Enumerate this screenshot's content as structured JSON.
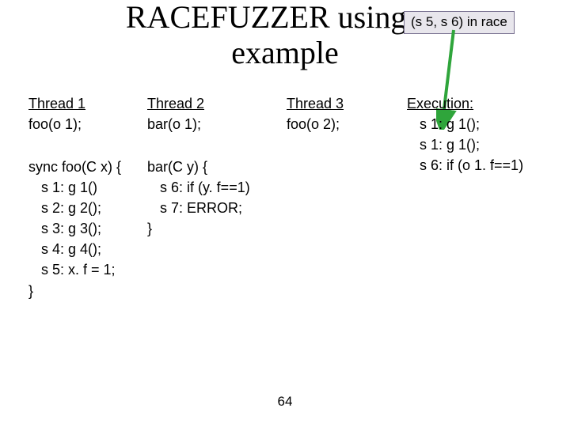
{
  "title_line1": "RACEFUZZER using an",
  "title_line2": "example",
  "badge": "(s 5, s 6) in race",
  "threads": {
    "t1": {
      "hd": "Thread 1",
      "call": "foo(o 1);"
    },
    "t2": {
      "hd": "Thread 2",
      "call": "bar(o 1);"
    },
    "t3": {
      "hd": "Thread 3",
      "call": "foo(o 2);"
    }
  },
  "exec": {
    "hd": "Execution:",
    "l1": "s 1:  g 1();",
    "l2": "s 1:  g 1();",
    "l3": "s 6:  if (o 1. f==1)"
  },
  "foo": {
    "sig": "sync foo(C x) {",
    "s1": "s 1:  g 1()",
    "s2": "s 2:  g 2();",
    "s3": "s 3:  g 3();",
    "s4": "s 4:  g 4();",
    "s5": "s 5:  x. f = 1;",
    "close": "}"
  },
  "bar": {
    "sig": "bar(C y) {",
    "s6": "s 6:  if (y. f==1)",
    "s7": "s 7:    ERROR;",
    "close": "}"
  },
  "pagenum": "64"
}
